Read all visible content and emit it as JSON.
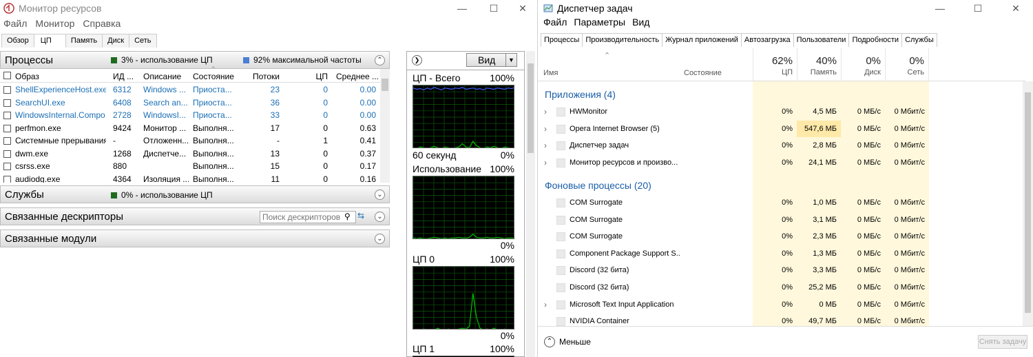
{
  "resmon": {
    "title": "Монитор ресурсов",
    "menu": [
      "Файл",
      "Монитор",
      "Справка"
    ],
    "tabs": [
      "Обзор",
      "ЦП",
      "Память",
      "Диск",
      "Сеть"
    ],
    "window_controls": {
      "min": "—",
      "max": "☐",
      "close": "✕"
    },
    "processes": {
      "title": "Процессы",
      "cpu_usage": "3% - использование ЦП",
      "max_freq": "92% максимальной частоты",
      "columns": [
        "Образ",
        "ИД ...",
        "Описание",
        "Состояние",
        "Потоки",
        "ЦП",
        "Среднее ..."
      ],
      "rows": [
        {
          "name": "ShellExperienceHost.exe",
          "pid": "6312",
          "desc": "Windows ...",
          "state": "Приоста...",
          "threads": "23",
          "cpu": "0",
          "avg": "0.00",
          "suspended": true
        },
        {
          "name": "SearchUI.exe",
          "pid": "6408",
          "desc": "Search an...",
          "state": "Приоста...",
          "threads": "36",
          "cpu": "0",
          "avg": "0.00",
          "suspended": true
        },
        {
          "name": "WindowsInternal.Compo...",
          "pid": "2728",
          "desc": "WindowsI...",
          "state": "Приоста...",
          "threads": "33",
          "cpu": "0",
          "avg": "0.00",
          "suspended": true
        },
        {
          "name": "perfmon.exe",
          "pid": "9424",
          "desc": "Монитор ...",
          "state": "Выполня...",
          "threads": "17",
          "cpu": "0",
          "avg": "0.63",
          "suspended": false
        },
        {
          "name": "Системные прерывания",
          "pid": "-",
          "desc": "Отложенн...",
          "state": "Выполня...",
          "threads": "-",
          "cpu": "1",
          "avg": "0.41",
          "suspended": false
        },
        {
          "name": "dwm.exe",
          "pid": "1268",
          "desc": "Диспетче...",
          "state": "Выполня...",
          "threads": "13",
          "cpu": "0",
          "avg": "0.37",
          "suspended": false
        },
        {
          "name": "csrss.exe",
          "pid": "880",
          "desc": "",
          "state": "Выполня...",
          "threads": "15",
          "cpu": "0",
          "avg": "0.17",
          "suspended": false
        },
        {
          "name": "audiodg.exe",
          "pid": "4364",
          "desc": "Изоляция ...",
          "state": "Выполня...",
          "threads": "11",
          "cpu": "0",
          "avg": "0.16",
          "suspended": false
        }
      ]
    },
    "services": {
      "title": "Службы",
      "cpu_usage": "0% - использование ЦП"
    },
    "handles": {
      "title": "Связанные дескрипторы",
      "search_placeholder": "Поиск дескрипторов"
    },
    "modules": {
      "title": "Связанные модули"
    },
    "graphs": {
      "view_label": "Вид",
      "cpu_total": {
        "title": "ЦП - Всего",
        "top": "100%",
        "bottom_left": "60 секунд",
        "bottom_right": "0%"
      },
      "usage": {
        "title": "Использование ...",
        "top": "100%",
        "bottom_right": "0%"
      },
      "cpu0": {
        "title": "ЦП 0",
        "top": "100%",
        "bottom_right": "0%"
      },
      "cpu1": {
        "title": "ЦП 1",
        "top": "100%"
      }
    },
    "colors": {
      "cpu_square": "#1e6b1e",
      "freq_square": "#4a7fd4",
      "graph_line": "#00c000",
      "freq_line": "#4060ff"
    }
  },
  "taskmgr": {
    "title": "Диспетчер задач",
    "menu": [
      "Файл",
      "Параметры",
      "Вид"
    ],
    "window_controls": {
      "min": "—",
      "max": "☐",
      "close": "✕"
    },
    "tabs": [
      "Процессы",
      "Производительность",
      "Журнал приложений",
      "Автозагрузка",
      "Пользователи",
      "Подробности",
      "Службы"
    ],
    "columns": {
      "name": "Имя",
      "status": "Состояние",
      "cpu": {
        "pct": "62%",
        "label": "ЦП"
      },
      "mem": {
        "pct": "40%",
        "label": "Память"
      },
      "disk": {
        "pct": "0%",
        "label": "Диск"
      },
      "net": {
        "pct": "0%",
        "label": "Сеть"
      }
    },
    "apps_group": "Приложения (4)",
    "apps": [
      {
        "name": "HWMonitor",
        "cpu": "0%",
        "mem": "4,5 МБ",
        "disk": "0 МБ/с",
        "net": "0 Мбит/с"
      },
      {
        "name": "Opera Internet Browser (5)",
        "cpu": "0%",
        "mem": "547,6 МБ",
        "disk": "0 МБ/с",
        "net": "0 Мбит/с"
      },
      {
        "name": "Диспетчер задач",
        "cpu": "0%",
        "mem": "2,8 МБ",
        "disk": "0 МБ/с",
        "net": "0 Мбит/с"
      },
      {
        "name": "Монитор ресурсов и произво...",
        "cpu": "0%",
        "mem": "24,1 МБ",
        "disk": "0 МБ/с",
        "net": "0 Мбит/с"
      }
    ],
    "bg_group": "Фоновые процессы (20)",
    "bg": [
      {
        "name": "COM Surrogate",
        "cpu": "0%",
        "mem": "1,0 МБ",
        "disk": "0 МБ/с",
        "net": "0 Мбит/с",
        "expand": false
      },
      {
        "name": "COM Surrogate",
        "cpu": "0%",
        "mem": "3,1 МБ",
        "disk": "0 МБ/с",
        "net": "0 Мбит/с",
        "expand": false
      },
      {
        "name": "COM Surrogate",
        "cpu": "0%",
        "mem": "2,3 МБ",
        "disk": "0 МБ/с",
        "net": "0 Мбит/с",
        "expand": false
      },
      {
        "name": "Component Package Support S...",
        "cpu": "0%",
        "mem": "1,3 МБ",
        "disk": "0 МБ/с",
        "net": "0 Мбит/с",
        "expand": false
      },
      {
        "name": "Discord (32 бита)",
        "cpu": "0%",
        "mem": "3,3 МБ",
        "disk": "0 МБ/с",
        "net": "0 Мбит/с",
        "expand": false
      },
      {
        "name": "Discord (32 бита)",
        "cpu": "0%",
        "mem": "25,2 МБ",
        "disk": "0 МБ/с",
        "net": "0 Мбит/с",
        "expand": false
      },
      {
        "name": "Microsoft Text Input Application",
        "cpu": "0%",
        "mem": "0 МБ",
        "disk": "0 МБ/с",
        "net": "0 Мбит/с",
        "expand": true
      },
      {
        "name": "NVIDIA Container",
        "cpu": "0%",
        "mem": "49,7 МБ",
        "disk": "0 МБ/с",
        "net": "0 Мбит/с",
        "expand": false
      }
    ],
    "less_label": "Меньше",
    "end_task_label": "Снять задачу",
    "colors": {
      "heat_light": "#fff8dc",
      "heat_strong": "#ffe9a8",
      "group": "#1a5ea8"
    }
  }
}
